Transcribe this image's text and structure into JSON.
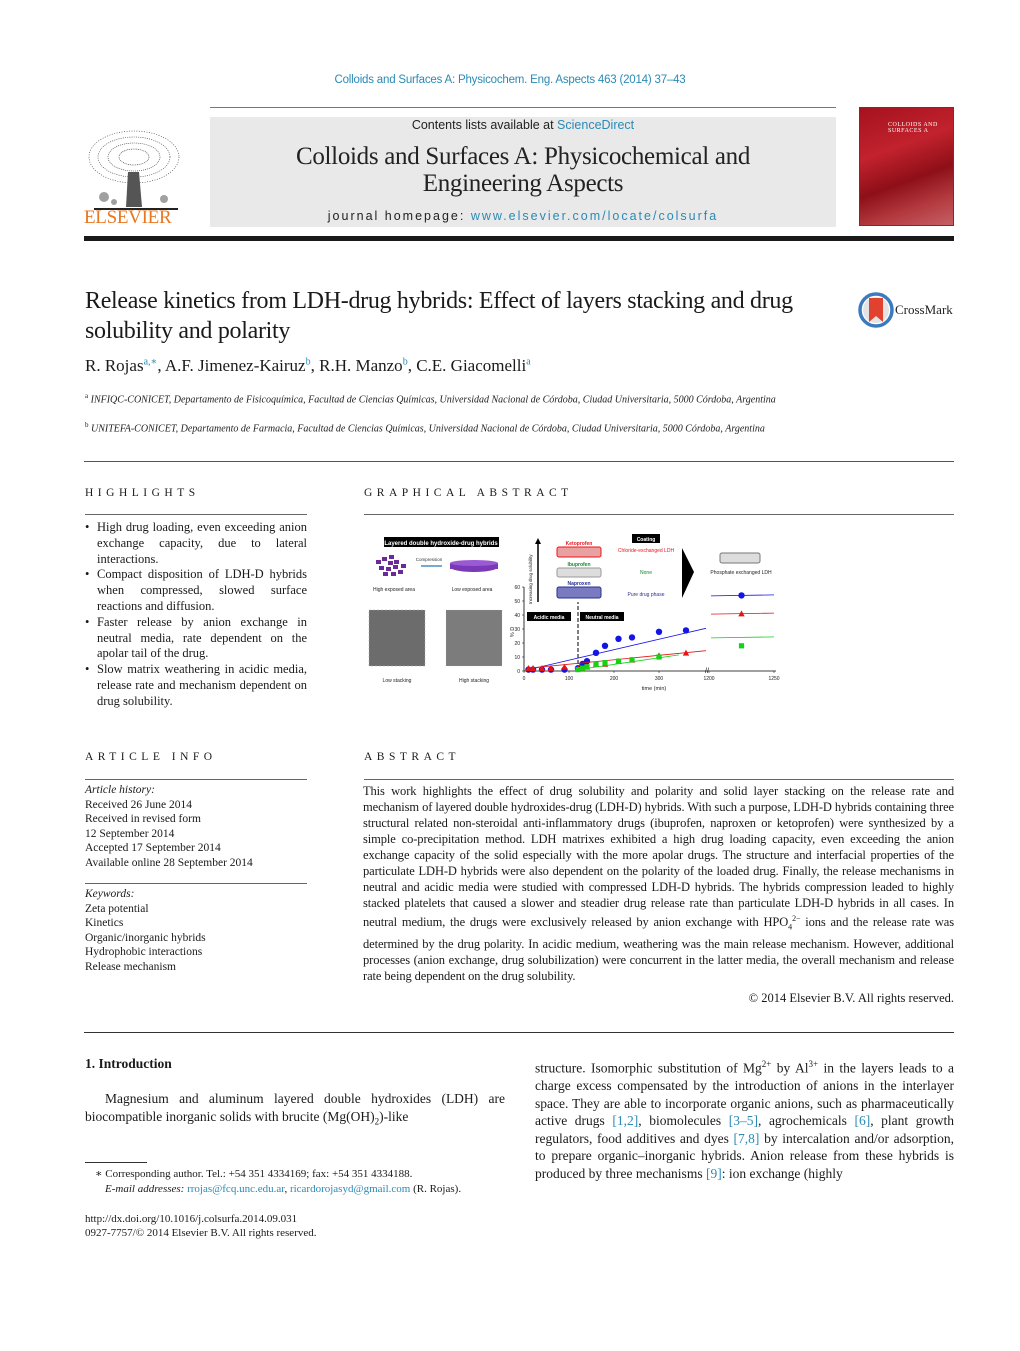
{
  "journal_ref": "Colloids and Surfaces A: Physicochem. Eng. Aspects 463 (2014) 37–43",
  "header": {
    "publisher": "ELSEVIER",
    "contents_prefix": "Contents lists available at ",
    "contents_link": "ScienceDirect",
    "journal_title_line1": "Colloids and Surfaces A: Physicochemical and",
    "journal_title_line2": "Engineering Aspects",
    "homepage_prefix": "journal homepage: ",
    "homepage_link": "www.elsevier.com/locate/colsurfa",
    "cover_title_line1": "COLLOIDS AND",
    "cover_title_line2": "SURFACES A"
  },
  "colors": {
    "link": "#2a8ab5",
    "elsevier_orange": "#e87722",
    "header_box": "#e9e9e9",
    "cover_red": "#b31b25"
  },
  "article": {
    "title": "Release kinetics from LDH-drug hybrids: Effect of layers stacking and drug solubility and polarity",
    "crossmark": "CrossMark",
    "authors": [
      {
        "name": "R. Rojas",
        "sup": "a,∗"
      },
      {
        "name": "A.F. Jimenez-Kairuz",
        "sup": "b"
      },
      {
        "name": "R.H. Manzo",
        "sup": "b"
      },
      {
        "name": "C.E. Giacomelli",
        "sup": "a"
      }
    ],
    "affiliations": [
      {
        "mark": "a",
        "text": "INFIQC-CONICET, Departamento de Fisicoquímica, Facultad de Ciencias Químicas, Universidad Nacional de Córdoba, Ciudad Universitaria, 5000 Córdoba, Argentina"
      },
      {
        "mark": "b",
        "text": "UNITEFA-CONICET, Departamento de Farmacia, Facultad de Ciencias Químicas, Universidad Nacional de Córdoba, Ciudad Universitaria, 5000 Córdoba, Argentina"
      }
    ]
  },
  "highlights": {
    "heading": "HIGHLIGHTS",
    "items": [
      "High drug loading, even exceeding anion exchange capacity, due to lateral interactions.",
      "Compact disposition of LDH-D hybrids when compressed, slowed surface reactions and diffusion.",
      "Faster release by anion exchange in neutral media, rate dependent on the apolar tail of the drug.",
      "Slow matrix weathering in acidic media, release rate and mechanism dependent on drug solubility."
    ]
  },
  "graphical_abstract": {
    "heading": "GRAPHICAL ABSTRACT",
    "left_title": "Layered double hydroxide-drug hybrids",
    "compression_label": "Compression",
    "high_exposed": "High exposed area",
    "low_exposed": "Low exposed area",
    "low_stacking": "Low stacking",
    "high_stacking": "High stacking",
    "solubility_axis": "Increasing drug solubility",
    "drugs": [
      {
        "name": "Ketoprofen",
        "color": "#e8141c",
        "coating": "Chloride-exchanged LDH"
      },
      {
        "name": "Ibuprofen",
        "color": "#138a2a",
        "coating": "None"
      },
      {
        "name": "Naproxen",
        "color": "#27318f",
        "coating": "Pure drug phase"
      }
    ],
    "coating_label": "Coating",
    "phosphate_label": "Phosphate exchanged LDH",
    "acidic_label": "Acidic media",
    "neutral_label": "Neutral media"
  },
  "chart_data": {
    "type": "scatter",
    "title": "",
    "xlabel": "time (min)",
    "ylabel": "% D",
    "xlim": [
      0,
      400
    ],
    "xlim_broken": [
      1200,
      1250
    ],
    "ylim": [
      0,
      60
    ],
    "x_ticks": [
      "0",
      "100",
      "200",
      "300",
      "1200",
      "1250"
    ],
    "y_ticks": [
      "0",
      "10",
      "20",
      "30",
      "40",
      "50",
      "60"
    ],
    "grid": false,
    "series": [
      {
        "name": "Naproxen",
        "marker": "circle",
        "color": "#1414e6",
        "x": [
          10,
          20,
          40,
          60,
          90,
          120,
          130,
          140,
          160,
          180,
          210,
          240,
          300,
          360,
          1225
        ],
        "y": [
          1,
          1,
          1,
          1,
          1,
          2,
          5,
          7,
          13,
          18,
          23,
          24,
          28,
          29,
          54
        ]
      },
      {
        "name": "Ketoprofen",
        "marker": "triangle",
        "color": "#e61414",
        "x": [
          10,
          20,
          40,
          60,
          90,
          120,
          130,
          140,
          160,
          180,
          210,
          240,
          300,
          360,
          1225
        ],
        "y": [
          2,
          2,
          2,
          2,
          3,
          2,
          2,
          3,
          5,
          5,
          7,
          8,
          11,
          13,
          41
        ]
      },
      {
        "name": "Ibuprofen",
        "marker": "square",
        "color": "#14d214",
        "x": [
          120,
          130,
          140,
          160,
          180,
          210,
          240,
          300,
          1225
        ],
        "y": [
          1,
          2,
          3,
          5,
          6,
          7,
          8,
          10,
          18
        ]
      }
    ]
  },
  "article_info": {
    "heading": "ARTICLE INFO",
    "history_label": "Article history:",
    "history": [
      "Received 26 June 2014",
      "Received in revised form",
      "12 September 2014",
      "Accepted 17 September 2014",
      "Available online 28 September 2014"
    ],
    "keywords_label": "Keywords:",
    "keywords": [
      "Zeta potential",
      "Kinetics",
      "Organic/inorganic hybrids",
      "Hydrophobic interactions",
      "Release mechanism"
    ]
  },
  "abstract": {
    "heading": "ABSTRACT",
    "text_part1": "This work highlights the effect of drug solubility and polarity and solid layer stacking on the release rate and mechanism of layered double hydroxides-drug (LDH-D) hybrids. With such a purpose, LDH-D hybrids containing three structural related non-steroidal anti-inflammatory drugs (ibuprofen, naproxen or ketoprofen) were synthesized by a simple co-precipitation method. LDH matrixes exhibited a high drug loading capacity, even exceeding the anion exchange capacity of the solid especially with the more apolar drugs. The structure and interfacial properties of the particulate LDH-D hybrids were also dependent on the polarity of the loaded drug. Finally, the release mechanisms in neutral and acidic media were studied with compressed LDH-D hybrids. The hybrids compression leaded to highly stacked platelets that caused a slower and steadier drug release rate than particulate LDH-D hybrids in all cases. In neutral medium, the drugs were exclusively released by anion exchange with HPO",
    "text_sub": "4",
    "text_sup": "2−",
    "text_part2": " ions and the release rate was determined by the drug polarity. In acidic medium, weathering was the main release mechanism. However, additional processes (anion exchange, drug solubilization) were concurrent in the latter media, the overall mechanism and release rate being dependent on the drug solubility.",
    "copyright": "© 2014 Elsevier B.V. All rights reserved."
  },
  "introduction": {
    "heading": "1.  Introduction",
    "left_col_a": "Magnesium and aluminum layered double hydroxides (LDH) are biocompatible inorganic solids with brucite (Mg(OH)",
    "left_col_sub": "2",
    "left_col_b": ")-like",
    "right_col_a": "structure. Isomorphic substitution of Mg",
    "right_sup1": "2+",
    "right_col_b": " by Al",
    "right_sup2": "3+",
    "right_col_c": " in the layers leads to a charge excess compensated by the introduction of anions in the interlayer space. They are able to incorporate organic anions, such as pharmaceutically active drugs ",
    "ref1": "[1,2]",
    "right_col_d": ", biomolecules ",
    "ref2": "[3–5]",
    "right_col_e": ", agrochemicals ",
    "ref3": "[6]",
    "right_col_f": ", plant growth regulators, food additives and dyes ",
    "ref4": "[7,8]",
    "right_col_g": " by intercalation and/or adsorption, to prepare organic–inorganic hybrids. Anion release from these hybrids is produced by three mechanisms ",
    "ref5": "[9]",
    "right_col_h": ": ion exchange (highly"
  },
  "footnotes": {
    "corresponding": "∗  Corresponding author. Tel.: +54 351 4334169; fax: +54 351 4334188.",
    "email_label": "E-mail addresses: ",
    "email1": "rrojas@fcq.unc.edu.ar",
    "email_sep": ", ",
    "email2": "ricardorojasyd@gmail.com",
    "email_suffix": " (R. Rojas).",
    "doi": "http://dx.doi.org/10.1016/j.colsurfa.2014.09.031",
    "issn": "0927-7757/© 2014 Elsevier B.V. All rights reserved."
  }
}
